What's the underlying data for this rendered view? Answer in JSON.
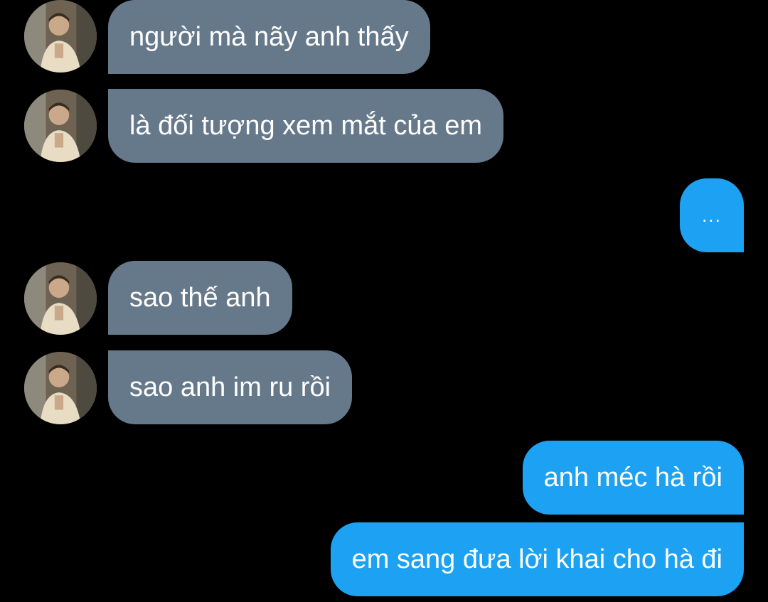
{
  "colors": {
    "background": "#000000",
    "incoming_bubble": "#66798b",
    "outgoing_bubble": "#1da1f2",
    "text": "#ffffff"
  },
  "messages": [
    {
      "direction": "incoming",
      "text": "người mà nãy anh thấy",
      "avatar": "contact-avatar"
    },
    {
      "direction": "incoming",
      "text": "là đối tượng xem mắt của em",
      "avatar": "contact-avatar"
    },
    {
      "direction": "outgoing",
      "text": "..."
    },
    {
      "direction": "incoming",
      "text": "sao thế anh",
      "avatar": "contact-avatar"
    },
    {
      "direction": "incoming",
      "text": "sao anh im ru rồi",
      "avatar": "contact-avatar"
    },
    {
      "direction": "outgoing",
      "text": "anh méc hà rồi"
    },
    {
      "direction": "outgoing",
      "text": "em sang đưa lời khai cho hà đi"
    }
  ]
}
